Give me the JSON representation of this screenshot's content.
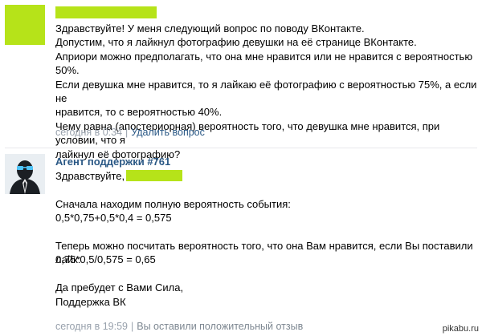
{
  "question": {
    "lines": [
      "Здравствуйте! У меня следующий вопрос по поводу ВКонтакте.",
      "Допустим, что я лайкнул фотографию девушки на её странице ВКонтакте.",
      "Априори можно предполагать, что она мне нравится или не нравится с вероятностью 50%.",
      "Если девушка мне нравится, то я лайкаю её фотографию с вероятностью 75%, а если не",
      "нравится, то с вероятностью 40%.",
      "Чему равна (апостериорная) вероятность того, что девушка мне нравится, при условии, что я",
      "лайкнул её фотографию?"
    ],
    "time": "сегодня в 0:34",
    "delete_label": "Удалить вопрос"
  },
  "answer": {
    "author": "Агент поддержки #761",
    "greeting": "Здравствуйте,",
    "lines": [
      "",
      "Сначала находим полную вероятность события:",
      "0,5*0,75+0,5*0,4 = 0,575",
      "",
      "Теперь можно посчитать вероятность того, что она Вам нравится, если Вы поставили лайк:",
      "0,75*0,5/0,575 = 0,65",
      "",
      "Да пребудет с Вами Сила,",
      "Поддержка ВК"
    ],
    "time": "сегодня в 19:59",
    "status": "Вы оставили положительный отзыв"
  },
  "watermark": "pikabu.ru",
  "colors": {
    "redaction": "#b6e319",
    "link": "#2a5885",
    "meta": "#99a2ad"
  }
}
